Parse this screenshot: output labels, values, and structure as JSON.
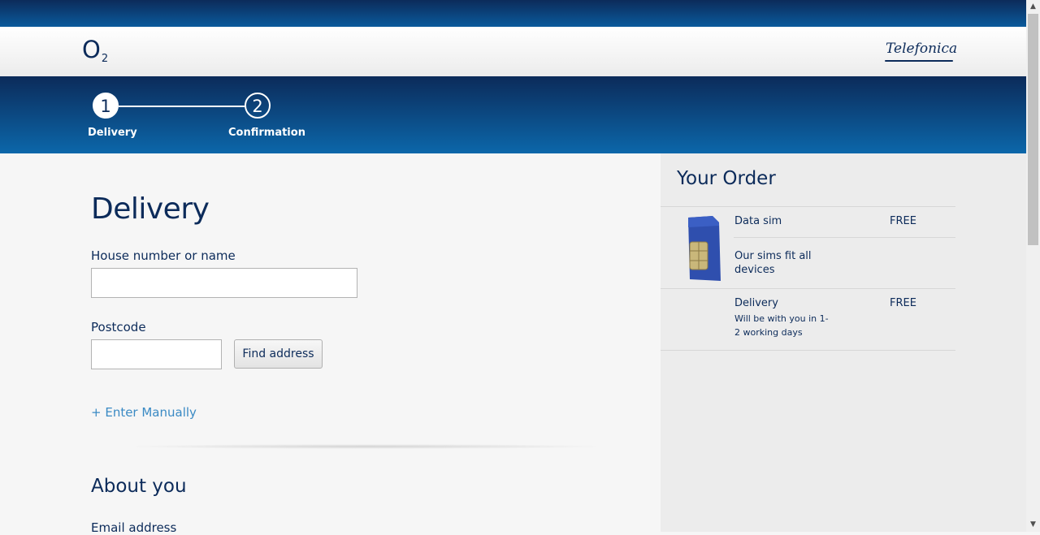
{
  "header": {
    "o2_logo_main": "O",
    "o2_logo_sub": "2",
    "partner_logo": "Telefonica"
  },
  "steps": [
    {
      "number": "1",
      "label": "Delivery"
    },
    {
      "number": "2",
      "label": "Confirmation"
    }
  ],
  "delivery": {
    "title": "Delivery",
    "house_label": "House number or name",
    "house_value": "",
    "postcode_label": "Postcode",
    "postcode_value": "",
    "find_address_label": "Find address",
    "enter_manually_label": "+ Enter Manually"
  },
  "about": {
    "title": "About you",
    "email_label": "Email address"
  },
  "order": {
    "title": "Your Order",
    "items": [
      {
        "name": "Data sim",
        "price": "FREE",
        "description": "Our sims fit all devices"
      },
      {
        "name": "Delivery",
        "price": "FREE",
        "description": "Will be with you in 1-2 working days"
      }
    ]
  },
  "colors": {
    "brand_navy": "#0c2b5a",
    "brand_blue": "#0c67aa",
    "link_blue": "#3a8ac4",
    "sim_blue": "#2f4fae"
  },
  "icons": {
    "sim": "sim-card-icon",
    "scroll_up": "chevron-up-icon",
    "scroll_down": "chevron-down-icon"
  }
}
